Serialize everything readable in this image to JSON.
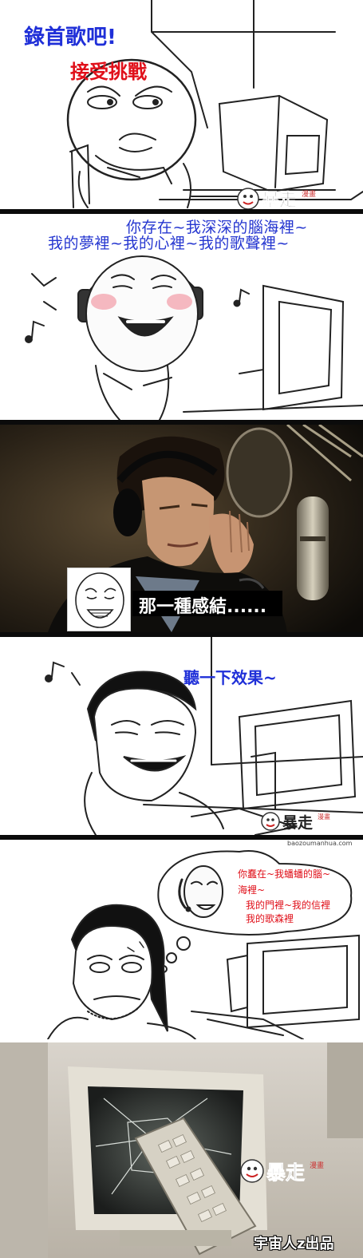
{
  "panels": [
    {
      "id": "p1",
      "captions": [
        "錄首歌吧!",
        "接受挑戰"
      ]
    },
    {
      "id": "p2",
      "lyrics": [
        "你存在~我深深的腦海裡~",
        "我的夢裡~我的心裡~我的歌聲裡~"
      ]
    },
    {
      "id": "p3",
      "caption": "那一種感結......"
    },
    {
      "id": "p4",
      "caption": "聽一下效果~"
    },
    {
      "id": "p5",
      "lyrics": [
        "你蠢在~我蟠蟠的腦~",
        "海裡~",
        "我的門裡~我的信裡",
        "我的歌森裡"
      ]
    },
    {
      "id": "p6",
      "credit": "宇宙人z出品"
    }
  ],
  "watermark": {
    "text": "暴走",
    "small": "漫畫",
    "site": "baozoumanhua.com"
  },
  "colors": {
    "caption_blue": "#1f2fd8",
    "caption_red": "#e0101a",
    "separator": "#0b0b0b"
  }
}
